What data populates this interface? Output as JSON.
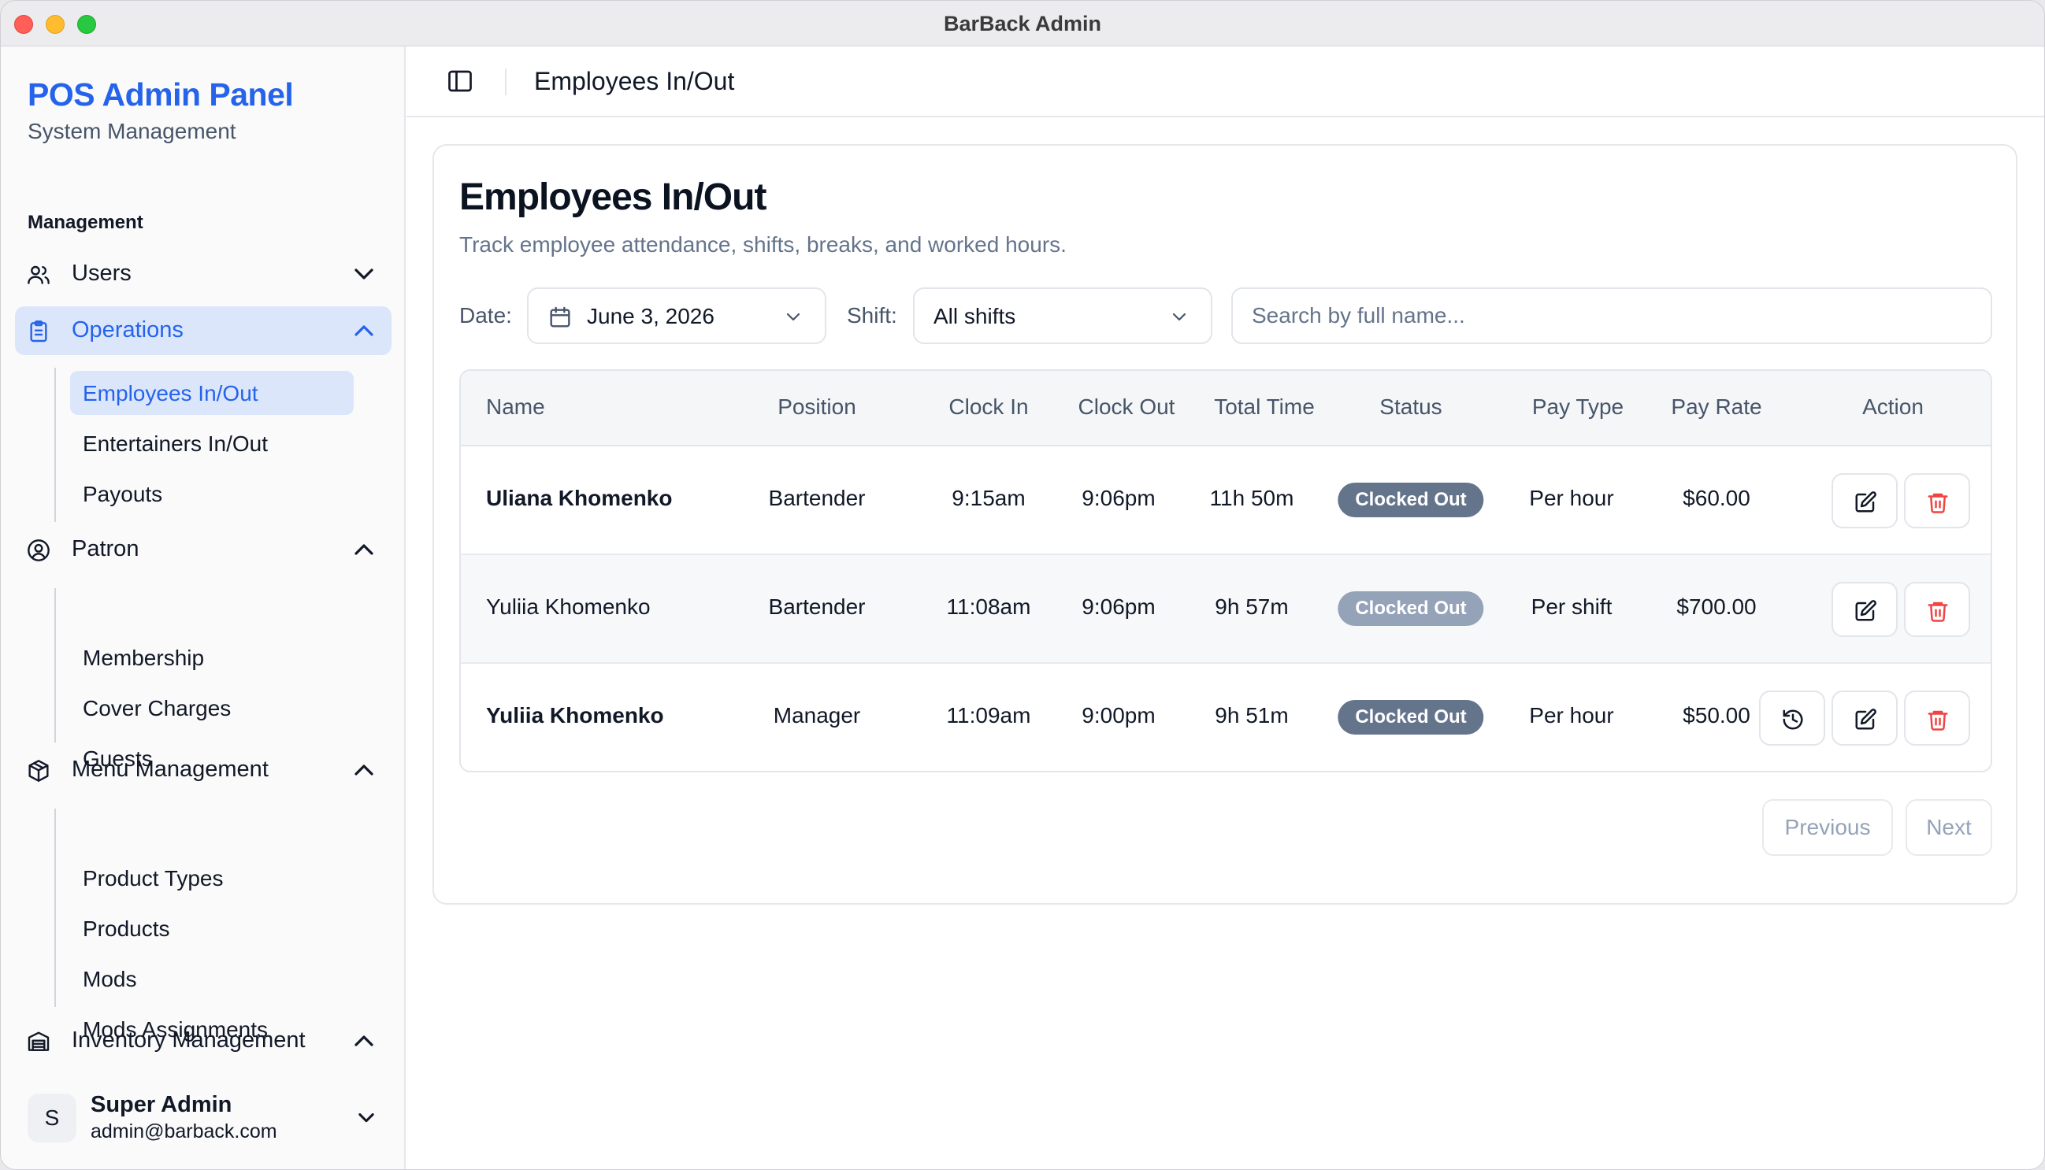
{
  "window": {
    "title": "BarBack Admin"
  },
  "sidebar": {
    "brand_title": "POS Admin Panel",
    "brand_subtitle": "System Management",
    "group_label": "Management",
    "nav": [
      {
        "label": "Users",
        "icon": "users-icon",
        "expanded": false
      },
      {
        "label": "Operations",
        "icon": "clipboard-icon",
        "expanded": true,
        "active": true,
        "items": [
          "Employees In/Out",
          "Entertainers In/Out",
          "Payouts"
        ]
      },
      {
        "label": "Patron",
        "icon": "user-circle-icon",
        "expanded": true,
        "items": [
          "Membership",
          "Cover Charges",
          "Guests"
        ]
      },
      {
        "label": "Menu Management",
        "icon": "package-icon",
        "expanded": true,
        "items": [
          "Product Types",
          "Products",
          "Mods",
          "Mods Assignments"
        ]
      },
      {
        "label": "Inventory Management",
        "icon": "warehouse-icon",
        "expanded": true
      }
    ],
    "active_item": "Employees In/Out",
    "user": {
      "initial": "S",
      "name": "Super Admin",
      "email": "admin@barback.com"
    }
  },
  "header": {
    "title": "Employees In/Out"
  },
  "page": {
    "title": "Employees In/Out",
    "description": "Track employee attendance, shifts, breaks, and worked hours.",
    "filters": {
      "date_label": "Date:",
      "date_value": "June 3, 2026",
      "shift_label": "Shift:",
      "shift_value": "All shifts",
      "search_placeholder": "Search by full name..."
    },
    "table": {
      "columns": [
        "Name",
        "Position",
        "Clock In",
        "Clock Out",
        "Total Time",
        "Status",
        "Pay Type",
        "Pay Rate",
        "Action"
      ],
      "rows": [
        {
          "name": "Uliana Khomenko",
          "position": "Bartender",
          "clock_in": "9:15am",
          "clock_out": "9:06pm",
          "total_time": "11h 50m",
          "status": "Clocked Out",
          "pay_type": "Per hour",
          "pay_rate": "$60.00"
        },
        {
          "name": "Yuliia Khomenko",
          "position": "Bartender",
          "clock_in": "11:08am",
          "clock_out": "9:06pm",
          "total_time": "9h 57m",
          "status": "Clocked Out",
          "pay_type": "Per shift",
          "pay_rate": "$700.00"
        },
        {
          "name": "Yuliia Khomenko",
          "position": "Manager",
          "clock_in": "11:09am",
          "clock_out": "9:00pm",
          "total_time": "9h 51m",
          "status": "Clocked Out",
          "pay_type": "Per hour",
          "pay_rate": "$50.00"
        }
      ]
    },
    "pagination": {
      "previous": "Previous",
      "next": "Next"
    }
  },
  "colors": {
    "accent": "#2563eb",
    "active_bg": "#dbe6fb",
    "badge": "#64748b",
    "delete": "#ef4444"
  }
}
